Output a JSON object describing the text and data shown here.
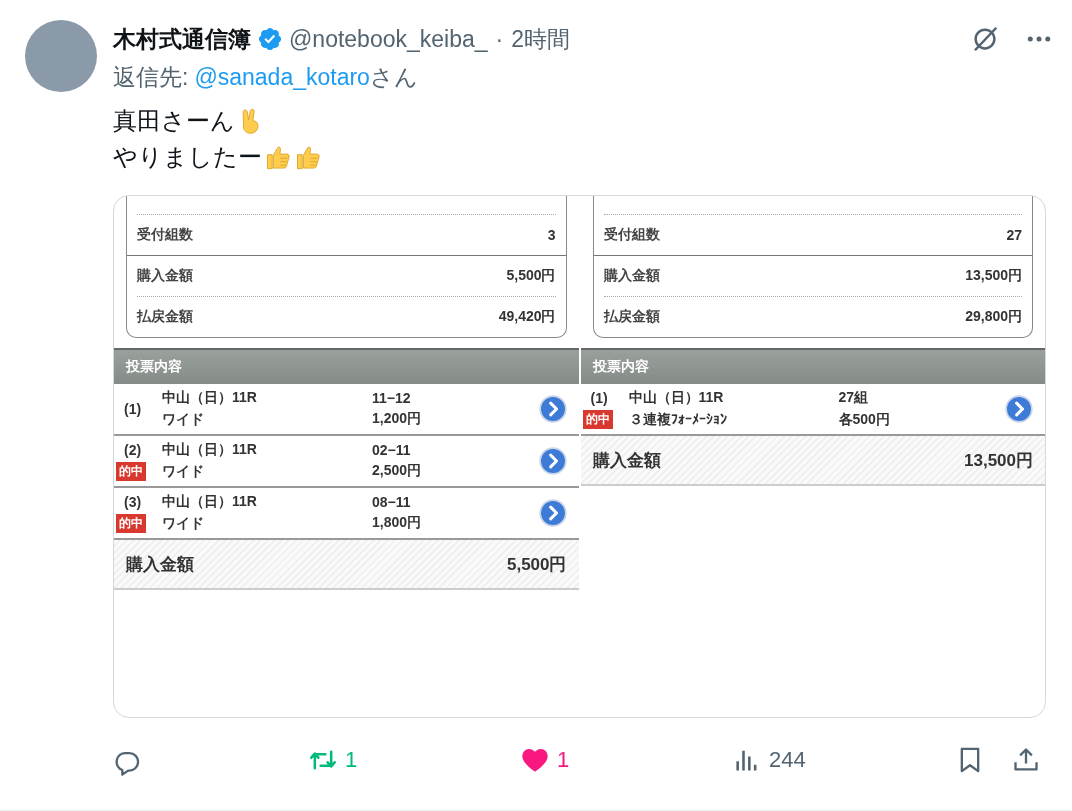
{
  "tweet": {
    "author": "木村式通信簿",
    "verified": true,
    "handle": "@notebook_keiba_",
    "separator": "·",
    "time": "2時間"
  },
  "reply_to": {
    "prefix": "返信先:",
    "mention": "@sanada_kotaro",
    "suffix": "さん"
  },
  "text_lines": [
    {
      "text": "真田さーん",
      "emoji": [
        {
          "kind": "victory"
        }
      ]
    },
    {
      "text": "やりましたー",
      "emoji": [
        {
          "kind": "thumbs_up"
        },
        {
          "kind": "thumbs_up"
        }
      ]
    }
  ],
  "receipts": [
    {
      "summary": [
        {
          "label": "受付組数",
          "value": "3"
        },
        {
          "label": "購入金額",
          "value": "5,500円"
        },
        {
          "label": "払戻金額",
          "value": "49,420円"
        }
      ],
      "section": "投票内容",
      "bets": [
        {
          "number": "(1)",
          "race": "中山（日）11R",
          "type": "ワイド",
          "combination": "11−12",
          "amount": "1,200円",
          "hit": false
        },
        {
          "number": "(2)",
          "race": "中山（日）11R",
          "type": "ワイド",
          "combination": "02−11",
          "amount": "2,500円",
          "hit": true,
          "hit_label": "的中"
        },
        {
          "number": "(3)",
          "race": "中山（日）11R",
          "type": "ワイド",
          "combination": "08−11",
          "amount": "1,800円",
          "hit": true,
          "hit_label": "的中"
        }
      ],
      "total": {
        "label": "購入金額",
        "value": "5,500円"
      }
    },
    {
      "summary": [
        {
          "label": "受付組数",
          "value": "27"
        },
        {
          "label": "購入金額",
          "value": "13,500円"
        },
        {
          "label": "払戻金額",
          "value": "29,800円"
        }
      ],
      "section": "投票内容",
      "bets": [
        {
          "number": "(1)",
          "race": "中山（日）11R",
          "type": "３連複ﾌｫｰﾒｰｼｮﾝ",
          "combination": "27組",
          "amount": "各500円",
          "hit": true,
          "hit_label": "的中"
        }
      ],
      "total": {
        "label": "購入金額",
        "value": "13,500円"
      }
    }
  ],
  "actions": [
    {
      "kind": "reply"
    },
    {
      "kind": "retweet",
      "count": "1",
      "on": true
    },
    {
      "kind": "like",
      "count": "1",
      "on": true
    },
    {
      "kind": "views",
      "count": "244"
    },
    {
      "kind": "bookmark",
      "on": false
    },
    {
      "kind": "share"
    }
  ]
}
